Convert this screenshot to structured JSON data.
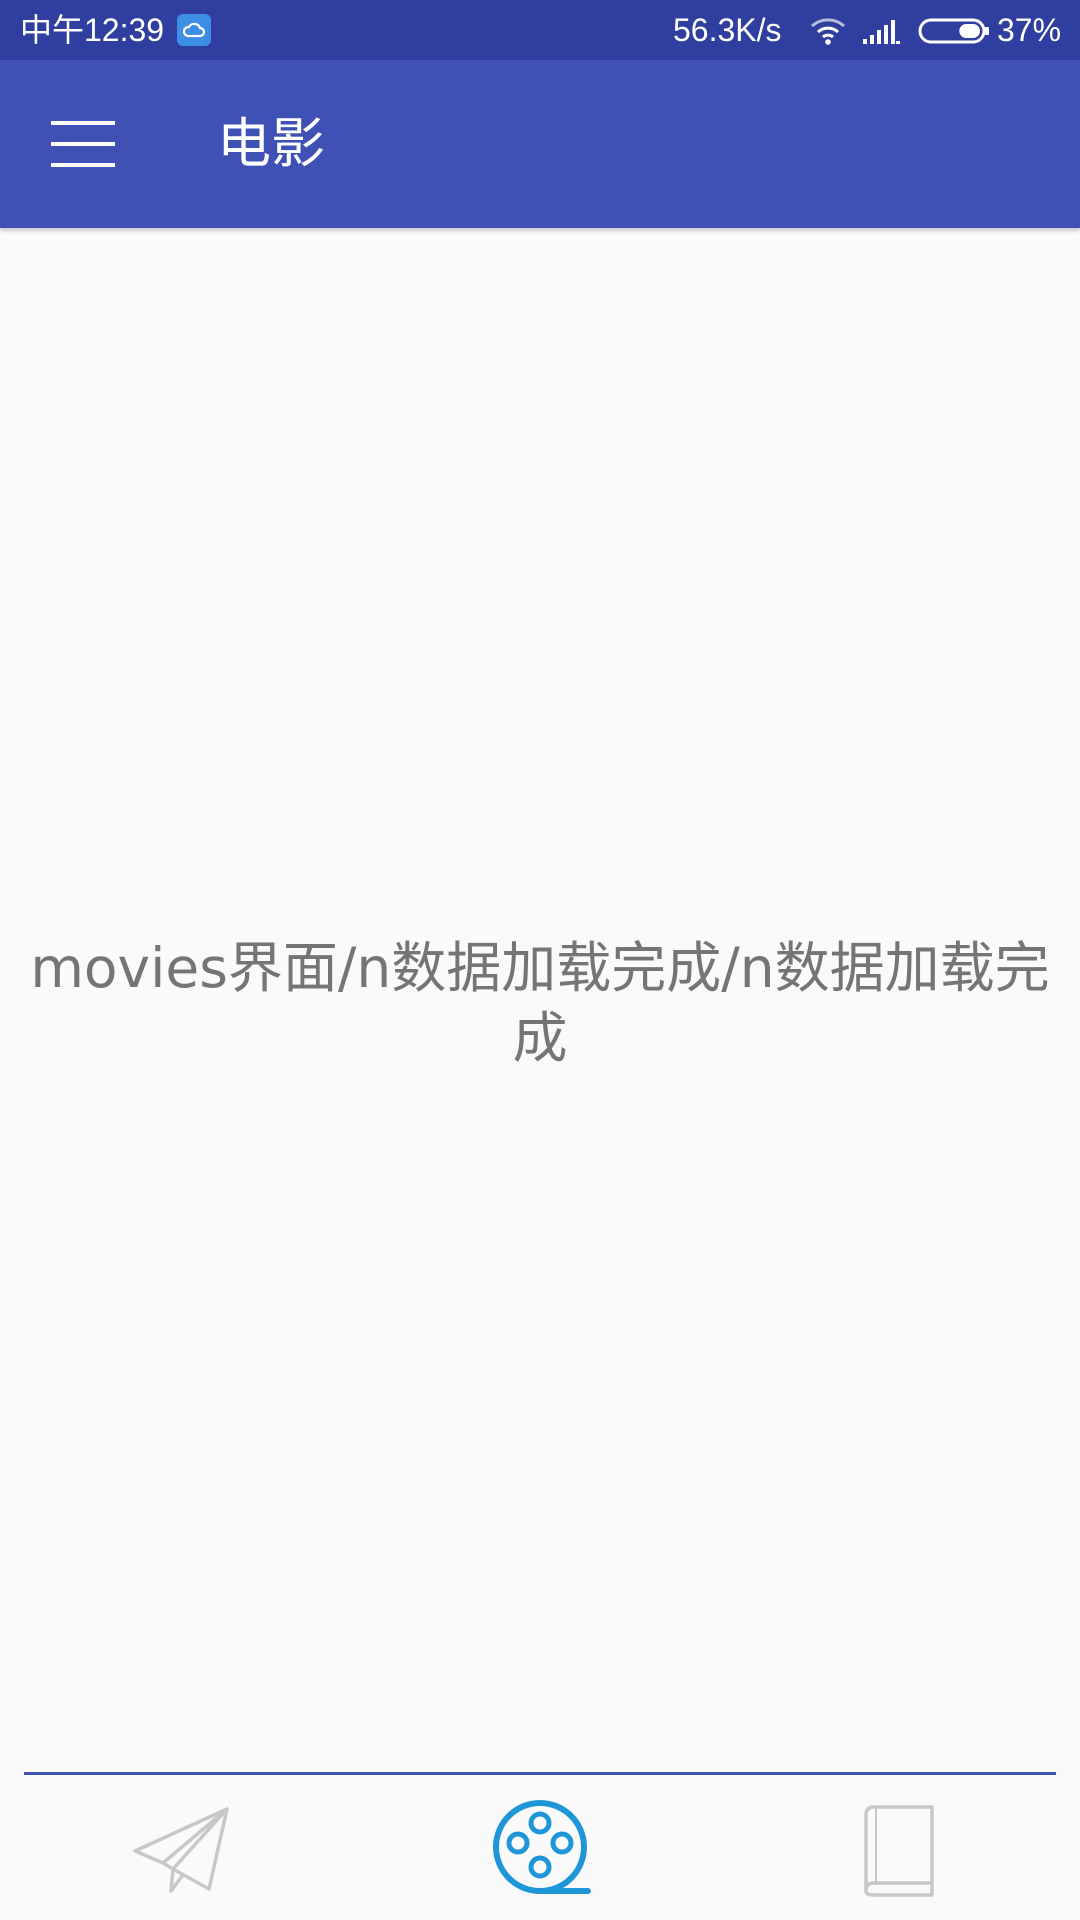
{
  "status_bar": {
    "time": "中午12:39",
    "network_speed": "56.3K/s",
    "battery_percent": "37%",
    "battery_level": 0.37,
    "icons": [
      "cloud-icon",
      "wifi-icon",
      "signal-icon",
      "battery-icon"
    ],
    "background_color": "#303f9f"
  },
  "app_bar": {
    "title": "电影",
    "menu_icon": "menu-icon",
    "background_color": "#3f51b5"
  },
  "main": {
    "message": "movies界面/n数据加载完成/n数据加载完成"
  },
  "bottom_nav": {
    "accent_color": "#1e96d7",
    "inactive_color": "#c8c8c8",
    "selected_index": 1,
    "items": [
      {
        "icon": "paper-plane-icon",
        "selected": false
      },
      {
        "icon": "film-reel-icon",
        "selected": true
      },
      {
        "icon": "book-icon",
        "selected": false
      }
    ]
  }
}
